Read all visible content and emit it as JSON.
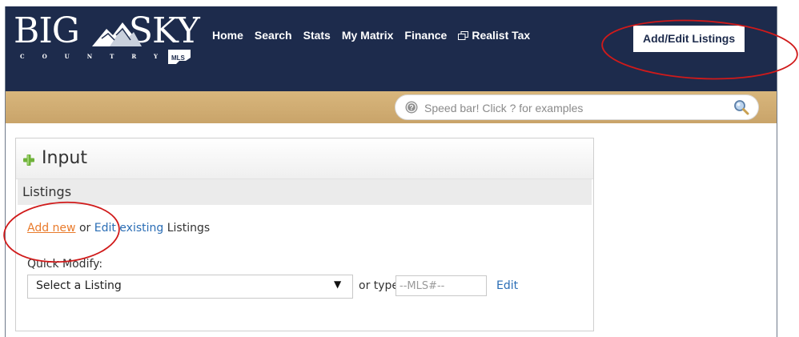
{
  "logo": {
    "big": "BIG",
    "sky": "SKY",
    "country": "COUNTRY",
    "mls": "MLS"
  },
  "nav": {
    "items": [
      "Home",
      "Search",
      "Stats",
      "My Matrix",
      "Finance"
    ],
    "realist_tax": "Realist Tax",
    "active": "Add/Edit Listings"
  },
  "speedbar": {
    "placeholder": "Speed bar! Click ? for examples",
    "help_icon": "help-circle-icon",
    "search_icon": "magnifier-icon"
  },
  "panel": {
    "title": "Input",
    "section": "Listings",
    "add_new": "Add new",
    "or": "or",
    "edit_existing": "Edit existing",
    "listings": "Listings",
    "quick_modify_label": "Quick Modify:",
    "select_value": "Select a Listing",
    "or_type": "or type",
    "mls_placeholder": "--MLS#--",
    "edit": "Edit"
  },
  "colors": {
    "header": "#1d2b4c",
    "gold": "#c9a46a",
    "annotation": "#d01a1a",
    "link_orange": "#e97b2c",
    "link_blue": "#2a6db5"
  }
}
